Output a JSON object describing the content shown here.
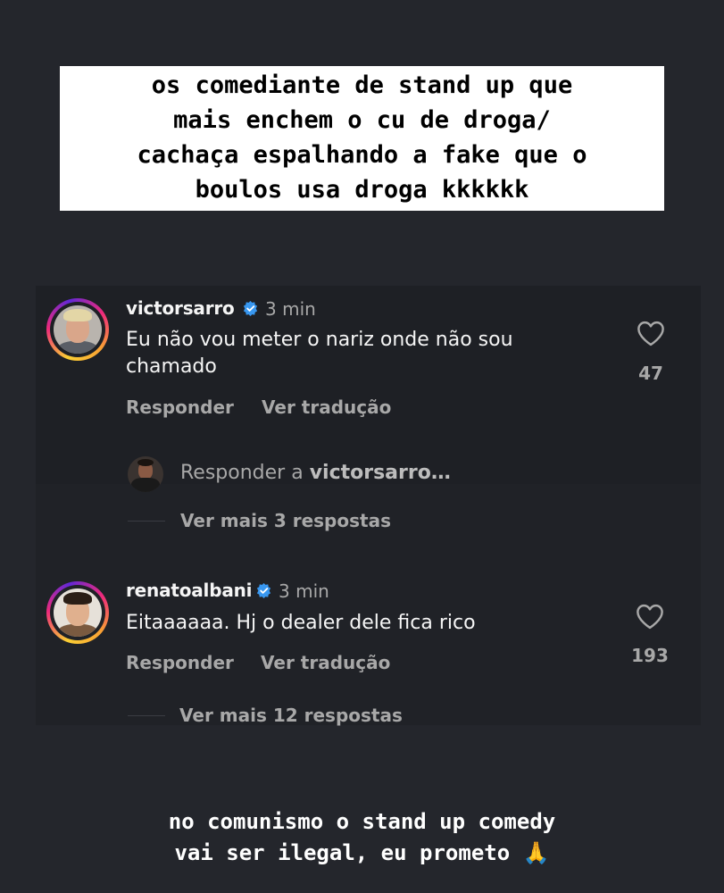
{
  "top_caption": {
    "lines": [
      "os comediante de stand up que",
      "mais enchem o cu de droga/",
      "cachaça espalhando a fake que o",
      "boulos usa droga kkkkkk"
    ]
  },
  "comments": [
    {
      "username": "victorsarro",
      "time": "3 min",
      "text_lines": [
        "Eu não vou meter o nariz onde não sou",
        "chamado"
      ],
      "reply_label": "Responder",
      "translate_label": "Ver tradução",
      "likes": "47",
      "more_replies": "Ver mais 3 respostas"
    },
    {
      "username": "renatoalbani",
      "time": "3 min",
      "text_lines": [
        "Eitaaaaaa. Hj o dealer dele fica rico"
      ],
      "reply_label": "Responder",
      "translate_label": "Ver tradução",
      "likes": "193",
      "more_replies": "Ver mais 12 respostas"
    }
  ],
  "reply_input": {
    "prefix": "Responder a ",
    "target": "victorsarro…"
  },
  "bottom_caption": {
    "lines": [
      "no comunismo o stand up comedy",
      "vai ser ilegal, eu prometo 🙏"
    ]
  },
  "colors": {
    "background": "#24262c",
    "verified_blue": "#3897f0",
    "muted_text": "#a8a8a8"
  },
  "icons": [
    "verified-badge-icon",
    "heart-icon",
    "folded-hands-emoji"
  ]
}
